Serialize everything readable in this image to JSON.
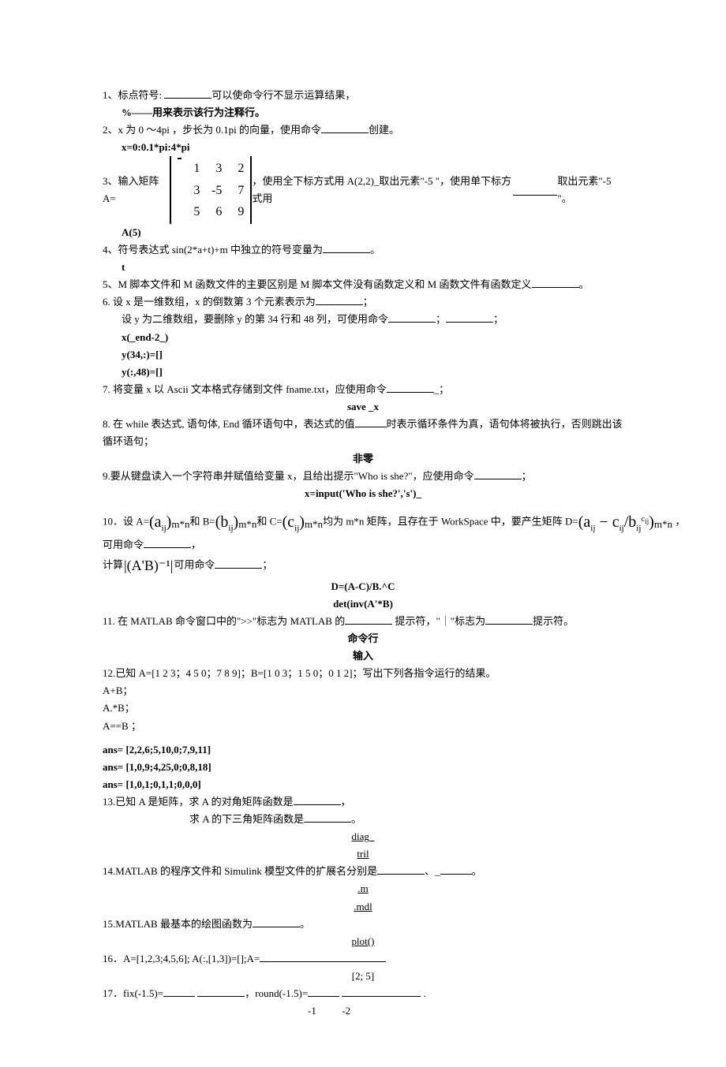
{
  "q1": {
    "text_a": "1、标点符号: ",
    "text_b": "可以使命令行不显示运算结果，",
    "ans": "%——用来表示该行为注释行。"
  },
  "q2": {
    "text_a": "2、x 为 0 ～4pi ，步长为 0.1pi 的向量，使用命令",
    "text_b": "创建。",
    "ans": "x=0:0.1*pi:4*pi"
  },
  "q3": {
    "text_a": "3、输入矩阵 A=",
    "text_b": "，使用全下标方式用 A(2,2)_取出元素\"-5 \"，使用单下标方式用",
    "text_c": "取出元素\"-5 \"。",
    "matrix": [
      [
        "1",
        "3",
        "2"
      ],
      [
        "3",
        "-5",
        "7"
      ],
      [
        "5",
        "6",
        "9"
      ]
    ],
    "ans": "A(5)"
  },
  "q4": {
    "text_a": "4、符号表达式 sin(2*a+t)+m 中独立的符号变量为",
    "text_b": "。",
    "ans": "t"
  },
  "q5": {
    "text_a": "5、M 脚本文件和 M 函数文件的主要区别是 M 脚本文件没有函数定义和 M 函数文件有函数定义",
    "text_b": "。"
  },
  "q6": {
    "line1_a": "6. 设 x 是一维数组，x 的倒数第 3 个元素表示为",
    "line1_b": "；",
    "line2_a": "设 y 为二维数组，要删除 y 的第 34 行和 48 列，可使用命令",
    "line2_b": "；",
    "line2_c": "；",
    "ans1": "x(_end-2_)",
    "ans2": "y(34,:)=[]",
    "ans3": "y(:,48)=[]"
  },
  "q7": {
    "text_a": "7. 将变量 x 以 Ascii 文本格式存储到文件 fname.txt，应使用命令",
    "text_b": "_；",
    "ans": "save _x"
  },
  "q8": {
    "text_a": "8. 在 while  表达式, 语句体, End 循环语句中，表达式的值",
    "text_b": "时表示循环条件为真，语句体将被执行，否则跳出该循环语句；",
    "ans": "非零"
  },
  "q9": {
    "text_a": "9.要从键盘读入一个字符串并赋值给变量 x，且给出提示\"Who is she?\"，应使用命令",
    "text_b": "；",
    "ans": "x=input('Who is she?','s')_"
  },
  "q10": {
    "line1_a": "10．设 A=",
    "f1": "(a",
    "f1_sub": "ij",
    "f1_close": ")",
    "mn": "m*n",
    "and": "和",
    "b_eq": " B=",
    "f2": "(b",
    "f2_sub": "ij",
    "f2_close": ")",
    "and_c": "和 C=",
    "f3": "(c",
    "f3_sub": "ij",
    "f3_close": ")",
    "line1_b": "均为 m*n 矩阵，且存在于 WorkSpace 中，要产生矩阵 D=",
    "f4_open": "(a",
    "f4_sub1": "ij",
    "f4_minus": " − c",
    "f4_sub2": "ij",
    "f4_div": "/b",
    "f4_sub3": "ij",
    "f4_sup": "c",
    "f4_supsub": "ij",
    "f4_close": ")",
    "comma": "，",
    "line2_a": "可用命令",
    "line2_b": "，",
    "line3_a": " 计算",
    "calc": "|(A'B)⁻¹|",
    "line3_b": "可用命令",
    "line3_c": "；",
    "ans1": "D=(A-C)/B.^C",
    "ans2": "det(inv(A'*B)"
  },
  "q11": {
    "text_a": "11. 在 MATLAB 命令窗口中的\">>\"标志为 MATLAB 的",
    "text_b": "提示符，\"｜\"标志为",
    "text_c": "提示符。",
    "ans1": "命令行",
    "ans2": "输入"
  },
  "q12": {
    "line1": "12.已知 A=[1 2 3；4 5 0；7 8 9]；B=[1 0 3；1 5 0；0 1 2]；写出下列各指令运行的结果。",
    "line2": "A+B；",
    "line3": "A.*B；",
    "line4": "A==B ；",
    "ans1": "ans= [2,2,6;5,10,0;7,9,11]",
    "ans2": "ans= [1,0,9;4,25,0;0,8,18]",
    "ans3": "ans= [1,0,1;0,1,1;0,0,0]"
  },
  "q13": {
    "line1_a": "13.已知 A 是矩阵，求 A 的对角矩阵函数是",
    "line1_b": "，",
    "line2_a": "求 A 的下三角矩阵函数是",
    "line2_b": "。",
    "ans1": "diag_",
    "ans2": "tril"
  },
  "q14": {
    "text_a": "14.MATLAB 的程序文件和 Simulink 模型文件的扩展名分别是",
    "text_b": "、_",
    "text_c": "。",
    "ans1": ".m",
    "ans2": ".mdl"
  },
  "q15": {
    "text_a": "15.MATLAB 最基本的绘图函数为",
    "text_b": "。",
    "ans": "plot()"
  },
  "q16": {
    "text_a": "16．A=[1,2,3;4,5,6]; A(:,[1,3])=[];A=",
    "ans": "[2; 5]"
  },
  "q17": {
    "text_a": "17．fix(-1.5)=",
    "text_b": "，round(-1.5)=",
    "text_c": " .",
    "ans": "-1          -2"
  }
}
